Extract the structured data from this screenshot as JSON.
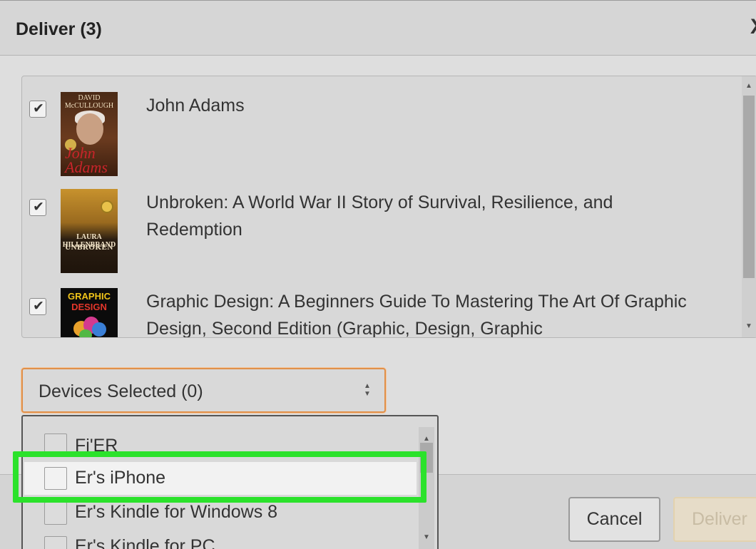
{
  "dialog": {
    "title": "Deliver (3)",
    "close_glyph": "X"
  },
  "books": [
    {
      "title": "John Adams",
      "checked": true,
      "cover": {
        "author": "DAVID McCULLOUGH",
        "script": "John Adams"
      }
    },
    {
      "title": "Unbroken: A World War II Story of Survival, Resilience, and Redemption",
      "checked": true,
      "cover": {
        "author": "LAURA HILLENBRAND",
        "title": "UNBROKEN"
      }
    },
    {
      "title": "Graphic Design: A Beginners Guide To Mastering The Art Of Graphic Design, Second Edition (Graphic, Design, Graphic",
      "checked": true,
      "cover": {
        "line1": "GRAPHIC",
        "line2": "DESIGN"
      }
    }
  ],
  "devices_select": {
    "label": "Devices Selected (0)"
  },
  "devices": [
    {
      "label": "Fi'ER",
      "checked": false
    },
    {
      "label": "Er's iPhone",
      "checked": false,
      "highlighted": true
    },
    {
      "label": "Er's Kindle for Windows 8",
      "checked": false
    },
    {
      "label": "Er's Kindle for PC",
      "checked": false
    }
  ],
  "buttons": {
    "cancel": "Cancel",
    "deliver": "Deliver"
  },
  "glyphs": {
    "check": "✔",
    "up": "▲",
    "down": "▼",
    "updown": "▲▼"
  },
  "colors": {
    "highlight_box": "#2be22b",
    "select_focus": "#e0904a",
    "deliver_disabled": "#e6dcc8"
  }
}
